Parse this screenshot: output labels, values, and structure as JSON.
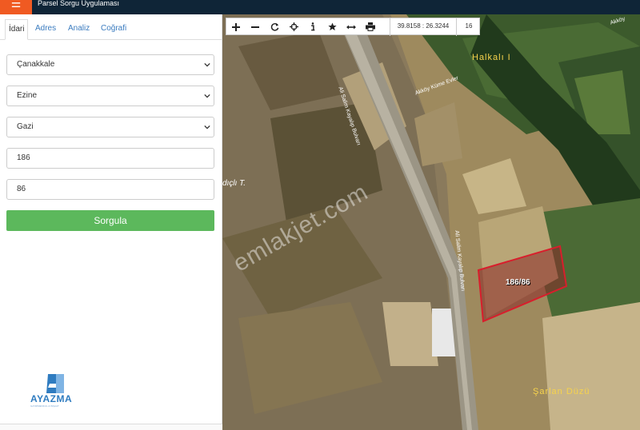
{
  "app": {
    "title": "Parsel Sorgu Uygulaması",
    "menu_glyph": "☰"
  },
  "tabs": [
    {
      "label": "İdari",
      "active": true
    },
    {
      "label": "Adres"
    },
    {
      "label": "Analiz"
    },
    {
      "label": "Coğrafi"
    }
  ],
  "form": {
    "province": "Çanakkale",
    "district": "Ezine",
    "neighborhood": "Gazi",
    "block": "186",
    "parcel": "86",
    "query_label": "Sorgula"
  },
  "logo": {
    "name": "AYAZMA",
    "tagline": "GAYRİMENKUL & İNŞAAT"
  },
  "map": {
    "coordinates": "39.8158 : 26.3244",
    "zoom": "16",
    "labels": {
      "village": "Halkalı I",
      "road_north": "Akköy Küme Evler",
      "road_edge": "Akköy",
      "boulevard": "Ali Salim Kayalıp Bulvarı",
      "south": "Şarlan Düzü",
      "west": "dıçlı T.",
      "parcel": "186/86",
      "watermark": "emlakjet.com"
    }
  },
  "colors": {
    "topbar": "#0f2537",
    "accent": "#f05a22",
    "tab_link": "#3a7bbf",
    "query_button": "#5cb85c",
    "parcel_outline": "#d81e2c"
  },
  "icons": [
    "plus-icon",
    "minus-icon",
    "refresh-icon",
    "crosshair-icon",
    "info-icon",
    "star-icon",
    "measure-icon",
    "print-icon"
  ]
}
